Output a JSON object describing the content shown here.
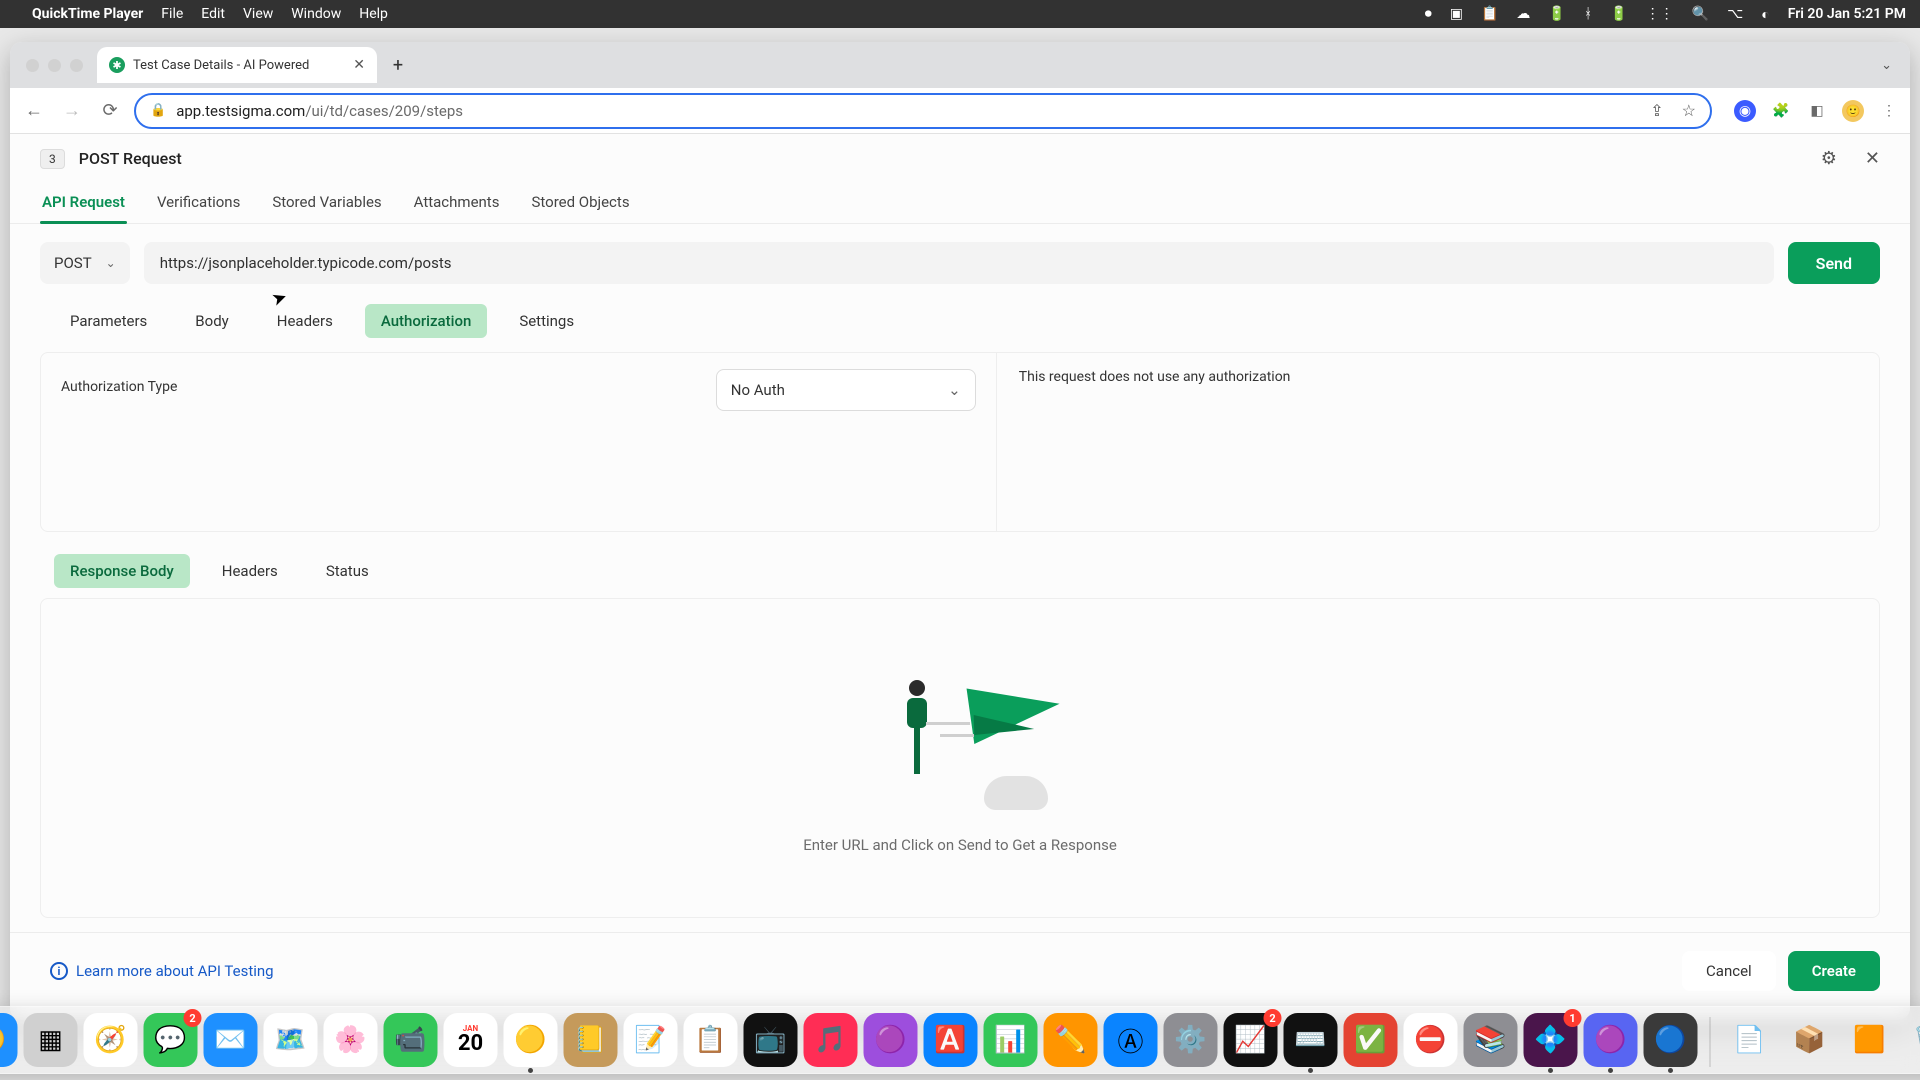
{
  "menubar": {
    "app": "QuickTime Player",
    "items": [
      "File",
      "Edit",
      "View",
      "Window",
      "Help"
    ],
    "clock": "Fri 20 Jan  5:21 PM"
  },
  "browser": {
    "tab_title": "Test Case Details - AI Powered",
    "url_origin": "app.testsigma.com",
    "url_path": "/ui/td/cases/209/steps"
  },
  "header": {
    "step_number": "3",
    "title": "POST Request"
  },
  "main_tabs": [
    "API Request",
    "Verifications",
    "Stored Variables",
    "Attachments",
    "Stored Objects"
  ],
  "main_tab_active": 0,
  "request": {
    "method": "POST",
    "url": "https://jsonplaceholder.typicode.com/posts",
    "send": "Send"
  },
  "sub_tabs": [
    "Parameters",
    "Body",
    "Headers",
    "Authorization",
    "Settings"
  ],
  "sub_tab_active": 3,
  "auth": {
    "label": "Authorization Type",
    "selected": "No Auth",
    "note": "This request does not use any authorization"
  },
  "response_tabs": [
    "Response Body",
    "Headers",
    "Status"
  ],
  "response_tab_active": 0,
  "response_hint": "Enter URL and Click on Send to Get a Response",
  "footer": {
    "learn": "Learn more about API Testing",
    "cancel": "Cancel",
    "create": "Create"
  },
  "dock": {
    "apps": [
      {
        "name": "finder",
        "emoji": "😀",
        "bg": "#1e90ff"
      },
      {
        "name": "launchpad",
        "emoji": "▦",
        "bg": "#d0d0d0"
      },
      {
        "name": "safari",
        "emoji": "🧭",
        "bg": "#fff"
      },
      {
        "name": "messages",
        "emoji": "💬",
        "bg": "#34c759",
        "badge": "2"
      },
      {
        "name": "mail",
        "emoji": "✉️",
        "bg": "#1e90ff"
      },
      {
        "name": "maps",
        "emoji": "🗺️",
        "bg": "#fff"
      },
      {
        "name": "photos",
        "emoji": "🌸",
        "bg": "#fff"
      },
      {
        "name": "facetime",
        "emoji": "📹",
        "bg": "#34c759"
      },
      {
        "name": "calendar",
        "emoji": "20",
        "bg": "#fff"
      },
      {
        "name": "chrome",
        "emoji": "🟡",
        "bg": "#fff",
        "running": true
      },
      {
        "name": "contacts",
        "emoji": "📒",
        "bg": "#c59a5b"
      },
      {
        "name": "notes",
        "emoji": "📝",
        "bg": "#fff"
      },
      {
        "name": "reminders",
        "emoji": "📋",
        "bg": "#fff"
      },
      {
        "name": "tv",
        "emoji": "📺",
        "bg": "#111"
      },
      {
        "name": "music",
        "emoji": "🎵",
        "bg": "#ff2d55"
      },
      {
        "name": "podcasts",
        "emoji": "🟣",
        "bg": "#9d4edd"
      },
      {
        "name": "appstore",
        "emoji": "🅰️",
        "bg": "#0a84ff"
      },
      {
        "name": "numbers",
        "emoji": "📊",
        "bg": "#34c759"
      },
      {
        "name": "pages",
        "emoji": "✏️",
        "bg": "#ff9500"
      },
      {
        "name": "appstore2",
        "emoji": "Ⓐ",
        "bg": "#0a84ff"
      },
      {
        "name": "settings",
        "emoji": "⚙️",
        "bg": "#8e8e93"
      },
      {
        "name": "activity",
        "emoji": "📈",
        "bg": "#111",
        "badge": "2"
      },
      {
        "name": "terminal",
        "emoji": "⌨️",
        "bg": "#111",
        "running": true
      },
      {
        "name": "todoist",
        "emoji": "✅",
        "bg": "#e44332"
      },
      {
        "name": "stop",
        "emoji": "⛔",
        "bg": "#fff"
      },
      {
        "name": "books",
        "emoji": "📚",
        "bg": "#8e8e93"
      },
      {
        "name": "slack",
        "emoji": "💠",
        "bg": "#4a154b",
        "badge": "1",
        "running": true
      },
      {
        "name": "discord",
        "emoji": "🟣",
        "bg": "#5865f2",
        "running": true
      },
      {
        "name": "quicktime",
        "emoji": "🔵",
        "bg": "#3a3a3a",
        "running": true
      }
    ],
    "right": [
      {
        "name": "document",
        "emoji": "📄",
        "bg": "transparent"
      },
      {
        "name": "box",
        "emoji": "📦",
        "bg": "transparent"
      },
      {
        "name": "folder",
        "emoji": "🟧",
        "bg": "transparent"
      },
      {
        "name": "trash",
        "emoji": "🗑️",
        "bg": "transparent"
      }
    ]
  }
}
